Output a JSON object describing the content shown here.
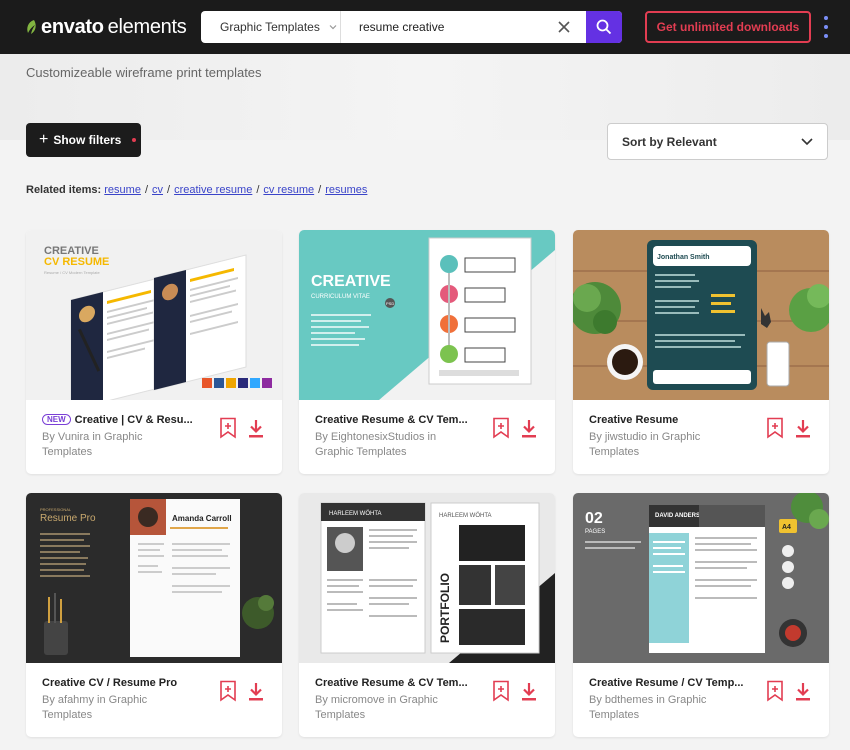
{
  "header": {
    "logo_part1": "envato",
    "logo_part2": "elements",
    "category": "Graphic Templates",
    "search_value": "resume creative",
    "cta_label": "Get unlimited downloads",
    "accent": "#6431e3",
    "cta_color": "#e23d52"
  },
  "hero": {
    "subtitle": "Customizeable wireframe print templates"
  },
  "toolbar": {
    "filters_label": "Show filters",
    "sort_label": "Sort by Relevant"
  },
  "related": {
    "label": "Related items:",
    "items": [
      "resume",
      "cv",
      "creative resume",
      "cv resume",
      "resumes"
    ]
  },
  "cards": [
    {
      "badge": "NEW",
      "title": "Creative | CV & Resu...",
      "author_line1": "By Vunira in Graphic",
      "author_line2": "Templates",
      "thumb": {
        "heading1": "CREATIVE",
        "heading2": "CV RESUME",
        "sub": "Resume / CV Modern Template"
      }
    },
    {
      "badge": "",
      "title": "Creative Resume & CV Tem...",
      "author_line1": "By EightonesixStudios in",
      "author_line2": "Graphic Templates",
      "thumb": {
        "heading1": "CREATIVE",
        "heading2": "CURRICULUM VITAE",
        "sub": "PSD"
      }
    },
    {
      "badge": "",
      "title": "Creative Resume",
      "author_line1": "By jiwstudio in Graphic",
      "author_line2": "Templates",
      "thumb": {
        "heading1": "Jonathan Smith"
      }
    },
    {
      "badge": "",
      "title": "Creative CV / Resume Pro",
      "author_line1": "By afahmy in Graphic",
      "author_line2": "Templates",
      "thumb": {
        "heading1": "Resume Pro",
        "heading2": "Amanda Carroll",
        "sub": "PROFESSIONAL"
      }
    },
    {
      "badge": "",
      "title": "Creative Resume & CV Tem...",
      "author_line1": "By micromove in Graphic",
      "author_line2": "Templates",
      "thumb": {
        "heading1": "HARLEEM WÖHTA",
        "heading2": "PORTFOLIO"
      }
    },
    {
      "badge": "",
      "title": "Creative Resume / CV Temp...",
      "author_line1": "By bdthemes in Graphic",
      "author_line2": "Templates",
      "thumb": {
        "heading1": "02",
        "heading2": "DAVID ANDERSON",
        "sub": "PAGES",
        "tag": "A4"
      }
    }
  ]
}
